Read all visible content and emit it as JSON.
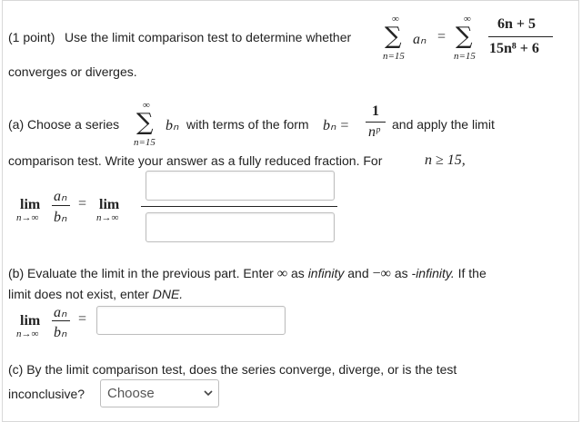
{
  "problem": {
    "points": "(1 point)",
    "intro": "Use the limit comparison test to determine whether",
    "converges_text": "converges or diverges."
  },
  "series_top": {
    "upper": "∞",
    "lower": "n=15",
    "term": "aₙ",
    "equals": "=",
    "numerator": "6n + 5",
    "denominator": "15n⁸ + 6"
  },
  "part_a": {
    "prefix": "(a) Choose a series",
    "upper": "∞",
    "lower": "n=15",
    "term": "bₙ",
    "middle": "with terms of the form",
    "form_lhs": "bₙ =",
    "form_num": "1",
    "form_den": "nᵖ",
    "suffix": "and apply the limit",
    "line2": "comparison test. Write your answer as a fully reduced fraction. For",
    "condition": "n ≥ 15,",
    "lim": "lim",
    "lim_sub": "n→∞",
    "ratio_num": "aₙ",
    "ratio_den": "bₙ",
    "equals": "="
  },
  "part_b": {
    "text1": "(b) Evaluate the limit in the previous part. Enter",
    "inf_symbol": "∞",
    "text2": "as",
    "infinity_word": "infinity",
    "text3": "and",
    "neg_inf_symbol": "−∞",
    "text4": "as",
    "neg_infinity_word": "-infinity.",
    "text5": "If the",
    "line2": "limit does not exist, enter",
    "dne": "DNE.",
    "lim": "lim",
    "lim_sub": "n→∞",
    "ratio_num": "aₙ",
    "ratio_den": "bₙ",
    "equals": "="
  },
  "part_c": {
    "line1": "(c) By the limit comparison test, does the series converge, diverge, or is the test",
    "line2": "inconclusive?",
    "select_value": "Choose"
  }
}
